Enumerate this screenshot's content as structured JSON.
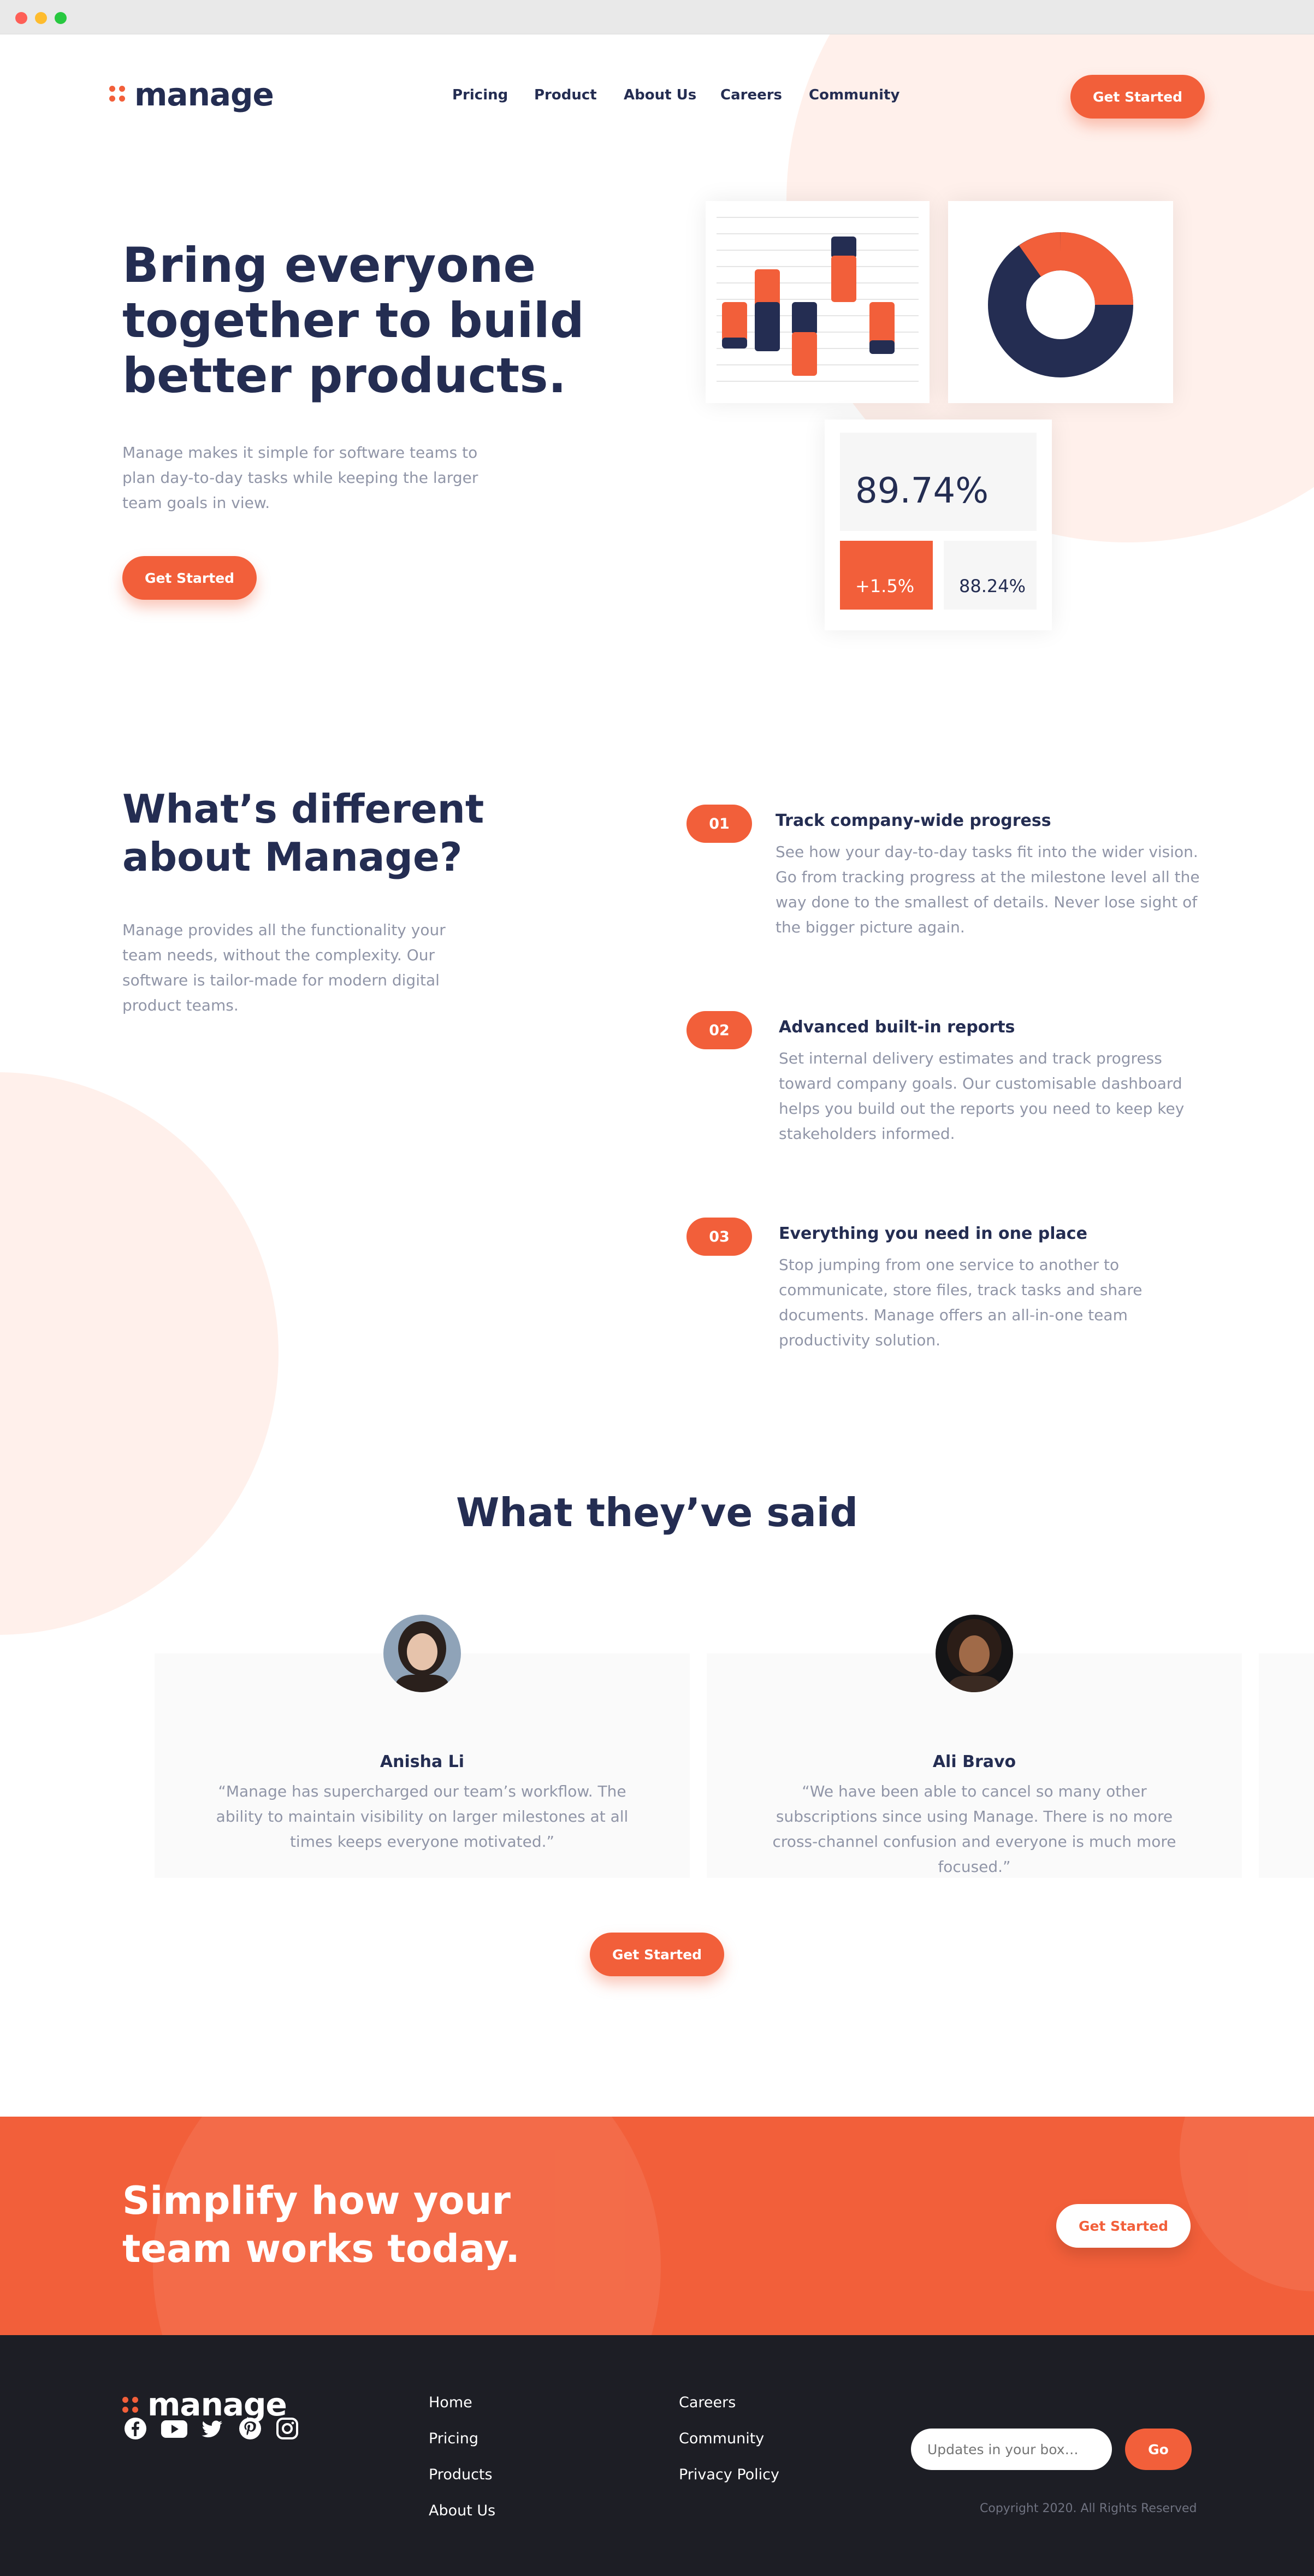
{
  "brand": {
    "name": "manage",
    "accent": "#f25f3a",
    "navy": "#242d52",
    "footer_bg": "#1d1e25"
  },
  "nav": {
    "items": [
      "Pricing",
      "Product",
      "About Us",
      "Careers",
      "Community"
    ],
    "cta": "Get Started"
  },
  "hero": {
    "title": "Bring everyone together to build better products.",
    "description": "Manage makes it simple for software teams to plan day-to-day tasks while keeping the larger team goals in view.",
    "cta": "Get Started",
    "stats": {
      "main": "89.74%",
      "delta": "+1.5%",
      "secondary": "88.24%"
    }
  },
  "features": {
    "title": "What’s different about Manage?",
    "description": "Manage provides all the functionality your team needs, without the complexity. Our software is tailor-made for modern digital product teams.",
    "items": [
      {
        "num": "01",
        "title": "Track company-wide progress",
        "desc": "See how your day-to-day tasks fit into the wider vision. Go from tracking progress at the milestone level all the way done to the smallest of details. Never lose sight of the bigger picture again."
      },
      {
        "num": "02",
        "title": "Advanced built-in reports",
        "desc": "Set internal delivery estimates and track progress toward company goals. Our customisable dashboard helps you build out the reports you need to keep key stakeholders informed."
      },
      {
        "num": "03",
        "title": "Everything you need in one place",
        "desc": "Stop jumping from one service to another to communicate, store files, track tasks and share documents. Manage offers an all-in-one team productivity solution."
      }
    ]
  },
  "testimonials": {
    "title": "What they’ve said",
    "items": [
      {
        "name": "Anisha Li",
        "quote": "“Manage has supercharged our team’s workflow. The ability to maintain visibility on larger milestones at all times keeps everyone motivated.”"
      },
      {
        "name": "Ali Bravo",
        "quote": "“We have been able to cancel so many other subscriptions since using Manage. There is no more cross-channel confusion and everyone is much more focused.”"
      }
    ],
    "cta": "Get Started"
  },
  "cta_band": {
    "title": "Simplify how your team works today.",
    "cta": "Get Started"
  },
  "footer": {
    "col1": [
      "Home",
      "Pricing",
      "Products",
      "About Us"
    ],
    "col2": [
      "Careers",
      "Community",
      "Privacy Policy"
    ],
    "newsletter": {
      "placeholder": "Updates in your box…",
      "button": "Go"
    },
    "copyright": "Copyright 2020. All Rights Reserved",
    "social": [
      "facebook-icon",
      "youtube-icon",
      "twitter-icon",
      "pinterest-icon",
      "instagram-icon"
    ]
  }
}
